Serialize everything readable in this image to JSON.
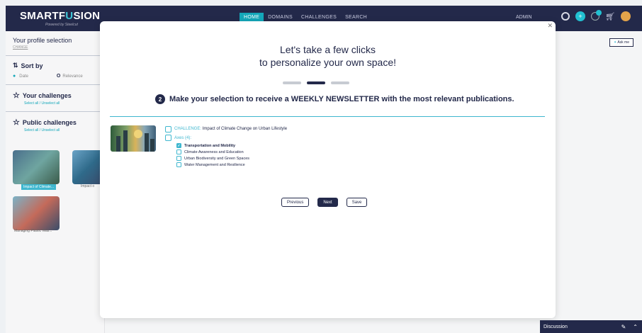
{
  "app": {
    "logo_main": "SMARTF",
    "logo_accent": "U",
    "logo_rest": "SION",
    "logo_sub": "Powered by Steelcut",
    "nav": [
      {
        "label": "HOME",
        "active": true
      },
      {
        "label": "DOMAINS",
        "active": false
      },
      {
        "label": "CHALLENGES",
        "active": false
      },
      {
        "label": "SEARCH",
        "active": false
      }
    ],
    "user": "ADMIN",
    "notification_count": "3"
  },
  "sidebar": {
    "profile_title": "Your profile selection",
    "profile_link": "CHANGE",
    "sort_title": "Sort by",
    "sort_options": [
      "Date",
      "Relevance"
    ],
    "your_challenges_title": "Your challenges",
    "your_challenges_link": "Select all / Unselect all",
    "public_challenges_title": "Public challenges",
    "public_challenges_link": "Select all / Unselect all",
    "cards": [
      "Impact of Climate...",
      "Impact o",
      "Managing Plastic Was..."
    ]
  },
  "ask_button": "Ask me",
  "modal": {
    "title_line1": "Let's take a few clicks",
    "title_line2": "to personalize your own space!",
    "step_number": "2",
    "instruction": "Make your selection to receive a WEEKLY NEWSLETTER with the most relevant publications.",
    "challenge_prefix": "CHALLENGE:",
    "challenge_name": "Impact of Climate Change on Urban Lifestyle",
    "axes_label": "Axes (4):",
    "axes": [
      {
        "label": "Transportation and Mobility",
        "checked": true
      },
      {
        "label": "Climate Awareness and Education",
        "checked": false
      },
      {
        "label": "Urban Biodiversity and Green Spaces",
        "checked": false
      },
      {
        "label": "Water Management and Resilience",
        "checked": false
      }
    ],
    "buttons": {
      "previous": "Previous",
      "next": "Next",
      "save": "Save"
    }
  },
  "discussion": {
    "label": "Discussion"
  },
  "colors": {
    "navy": "#23294a",
    "teal": "#3fb7cf"
  }
}
